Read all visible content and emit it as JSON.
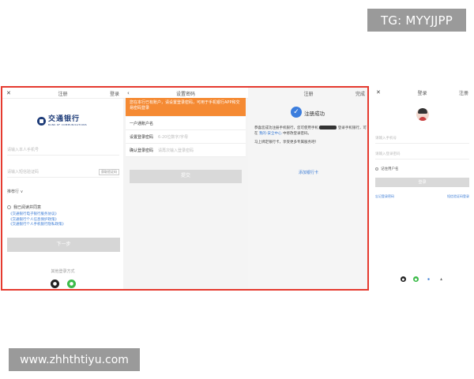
{
  "watermark_top": "TG: MYYJJPP",
  "watermark_bottom": "www.zhhthtiyu.com",
  "panel1": {
    "close": "✕",
    "title": "注册",
    "login": "登录",
    "logo_cn": "交通银行",
    "logo_en": "BANK OF COMMUNICATIONS",
    "phone_placeholder": "请输入本人手机号",
    "sms_placeholder": "请输入短信验证码",
    "sms_button": "获取验证码",
    "select": "推荐行 ∨",
    "agree": "我已阅读并同意",
    "links": [
      "《交通银行电子银行服务协议》",
      "《交通银行个人信息保护政策》",
      "《交通银行个人手机银行隐私政策》"
    ],
    "next": "下一步",
    "other_login": "其他登录方式"
  },
  "panel2": {
    "back": "‹",
    "title": "设置密码",
    "tip": "您在本行已有账户，请设置登录密码，可用于手机银行APP和交易密码登录",
    "rows": [
      {
        "label": "一户通账户名",
        "hint": ""
      },
      {
        "label": "设置登录密码",
        "hint": "6-20位数字/字母"
      },
      {
        "label": "确认登录密码",
        "hint": "请再次输入登录密码"
      }
    ],
    "submit": "提交"
  },
  "panel3": {
    "title": "注册",
    "done": "完成",
    "success": "注册成功",
    "msg_a": "恭喜您成功注册手机银行，您可使用手机",
    "msg_b": "登录手机银行，可在",
    "msg_link": "我的-安全中心",
    "msg_c": "中修改登录密码。",
    "msg_d": "马上绑定银行卡，享受更多专属服务吧！",
    "add_card": "添加银行卡"
  },
  "panel4": {
    "close": "✕",
    "title": "登录",
    "register": "注册",
    "phone_placeholder": "请输入手机号",
    "password_placeholder": "请输入登录密码",
    "remember": "记住用户名",
    "login": "登录",
    "forgot": "忘记登录密码",
    "sms_login": "短信验证码登录"
  },
  "colors": {
    "frame_border": "#e53a2f",
    "tip_bg": "#f58a33",
    "link_blue": "#3a7bd5",
    "bank_navy": "#1d3b78",
    "success_blue": "#3b7ddd"
  }
}
